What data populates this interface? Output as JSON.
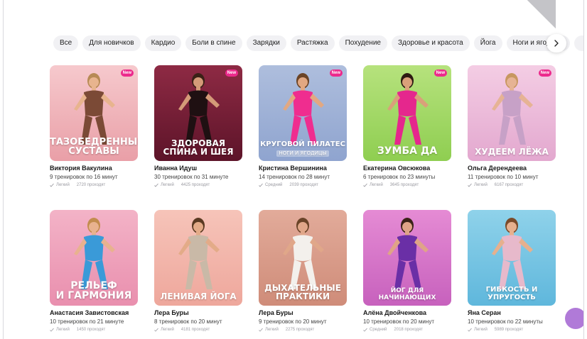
{
  "categories": [
    "Все",
    "Для новичков",
    "Кардио",
    "Боли в спине",
    "Зарядки",
    "Растяжка",
    "Похудение",
    "Здоровье и красота",
    "Йога",
    "Ноги и ягодицы",
    ""
  ],
  "new_badge": "New",
  "cards": [
    {
      "title_l1": "Тазобедренные",
      "title_l2": "суставы",
      "subtitle": "",
      "author": "Виктория Вакулина",
      "count": "9 тренировок по 16 минут",
      "level": "Легкий",
      "views": "2720 проходят",
      "is_new": true,
      "bg_top": "#f6c9cd",
      "bg_bottom": "#e99fa7",
      "outfit": "#7b4a36",
      "skin": "#e8b48e",
      "hair": "#b78a55"
    },
    {
      "title_l1": "Здоровая",
      "title_l2": "спина и шея",
      "subtitle": "",
      "author": "Иванна Идуш",
      "count": "30 тренировок по 31 минуте",
      "level": "Легкий",
      "views": "4425 проходят",
      "is_new": true,
      "bg_top": "#8e2a44",
      "bg_bottom": "#5d1429",
      "outfit": "#1f1012",
      "skin": "#d49a78",
      "hair": "#3a2116"
    },
    {
      "title_l1": "Круговой пилатес",
      "title_l2": "",
      "subtitle": "ноги и ягодицы",
      "author": "Кристина Вершинина",
      "count": "14 тренировок по 28 минут",
      "level": "Средний",
      "views": "2039 проходят",
      "is_new": true,
      "bg_top": "#aebedd",
      "bg_bottom": "#8fa4cf",
      "outfit": "#ef2d8f",
      "skin": "#e2a882",
      "hair": "#6b4426"
    },
    {
      "title_l1": "Зумба да",
      "title_l2": "",
      "subtitle": "",
      "author": "Екатерина Овсюкова",
      "count": "6 тренировок по 23 минуты",
      "level": "Легкий",
      "views": "3645 проходят",
      "is_new": true,
      "bg_top": "#b6e27d",
      "bg_bottom": "#8fce51",
      "outfit": "#e5278d",
      "skin": "#d9a07a",
      "hair": "#2d1b12"
    },
    {
      "title_l1": "Худеем лёжа",
      "title_l2": "",
      "subtitle": "",
      "author": "Ольга Дерендеева",
      "count": "11 тренировок по 10 минут",
      "level": "Легкий",
      "views": "6167 проходят",
      "is_new": true,
      "bg_top": "#f4cde4",
      "bg_bottom": "#e3a8cf",
      "outfit": "#c7a1c7",
      "skin": "#e6b394",
      "hair": "#c79760"
    },
    {
      "title_l1": "Рельеф",
      "title_l2": "и гармония",
      "subtitle": "",
      "author": "Анастасия Завистовская",
      "count": "10 тренировок по 21 минуте",
      "level": "Легкий",
      "views": "1450 проходят",
      "is_new": false,
      "bg_top": "#f3b3c7",
      "bg_bottom": "#e98fae",
      "outfit": "#3a9ad8",
      "skin": "#e8b28f",
      "hair": "#c28c4e"
    },
    {
      "title_l1": "Ленивая йога",
      "title_l2": "",
      "subtitle": "",
      "author": "Лера Буры",
      "count": "8 тренировок по 20 минут",
      "level": "Легкий",
      "views": "4181 проходят",
      "is_new": false,
      "bg_top": "#f6c4b9",
      "bg_bottom": "#eea79c",
      "outfit": "#c9b9a7",
      "skin": "#e3ab88",
      "hair": "#5a3a22"
    },
    {
      "title_l1": "Дыхательные",
      "title_l2": "практики",
      "subtitle": "",
      "author": "Лера Буры",
      "count": "9 тренировок по 20 минут",
      "level": "Легкий",
      "views": "2275 проходят",
      "is_new": false,
      "bg_top": "#e2ab9a",
      "bg_bottom": "#cf8c79",
      "outfit": "#f3f0ec",
      "skin": "#e0a789",
      "hair": "#6a4428"
    },
    {
      "title_l1": "Йог для начинающих",
      "title_l2": "",
      "subtitle": "",
      "author": "Алёна Двойченкова",
      "count": "10 тренировок по 20 минут",
      "level": "Средний",
      "views": "2018 проходят",
      "is_new": false,
      "bg_top": "#e58bd4",
      "bg_bottom": "#c761bd",
      "outfit": "#6a2fa6",
      "skin": "#dfa487",
      "hair": "#3b2318"
    },
    {
      "title_l1": "Гибкость и упругость",
      "title_l2": "",
      "subtitle": "",
      "author": "Яна Серан",
      "count": "10 тренировок по 22 минуты",
      "level": "Легкий",
      "views": "5989 проходят",
      "is_new": false,
      "bg_top": "#8fd2ea",
      "bg_bottom": "#5fb7dc",
      "outfit": "#e7b9cb",
      "skin": "#e6b08e",
      "hair": "#7a4b2a"
    }
  ],
  "icons": {
    "next": "chevron-right-icon",
    "level": "level-check-icon",
    "chat": "chat-bubble-icon"
  }
}
